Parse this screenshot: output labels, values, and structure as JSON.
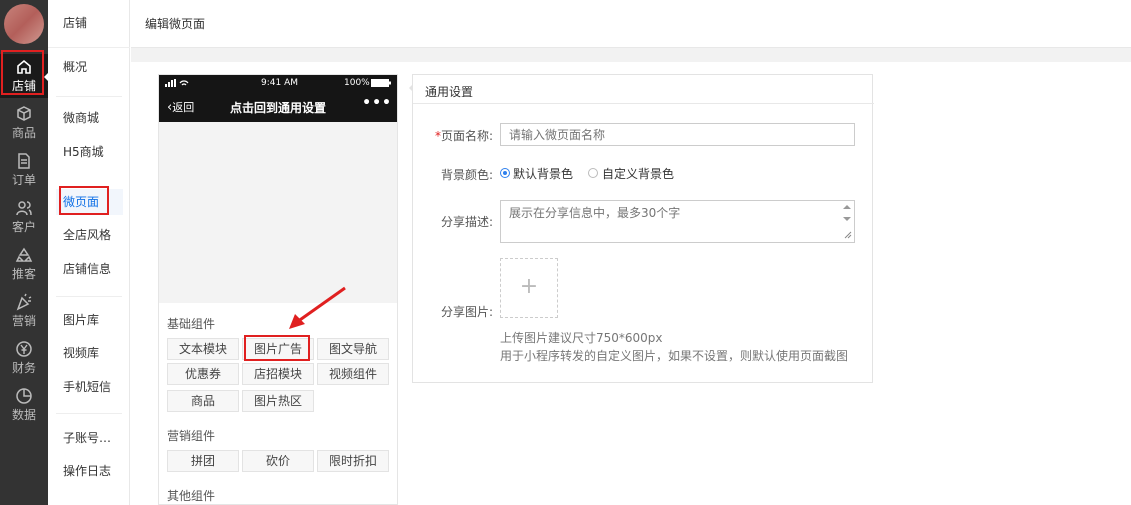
{
  "rail": {
    "items": [
      {
        "label": "店铺",
        "icon": "home-icon"
      },
      {
        "label": "商品",
        "icon": "cube-icon"
      },
      {
        "label": "订单",
        "icon": "document-icon"
      },
      {
        "label": "客户",
        "icon": "users-icon"
      },
      {
        "label": "推客",
        "icon": "recycle-icon"
      },
      {
        "label": "营销",
        "icon": "party-icon"
      },
      {
        "label": "财务",
        "icon": "yen-icon"
      },
      {
        "label": "数据",
        "icon": "pie-chart-icon"
      }
    ]
  },
  "subnav": {
    "title": "店铺",
    "items": [
      "概况",
      "微商城",
      "H5商城",
      "微页面",
      "全店风格",
      "店铺信息",
      "图片库",
      "视频库",
      "手机短信",
      "子账号…",
      "操作日志"
    ]
  },
  "header": {
    "breadcrumb": "编辑微页面"
  },
  "phone": {
    "time": "9:41 AM",
    "battery": "100%",
    "back": "返回",
    "title": "点击回到通用设置",
    "more": "•••",
    "groups": [
      {
        "label": "基础组件",
        "items": [
          "文本模块",
          "图片广告",
          "图文导航",
          "优惠券",
          "店招模块",
          "视频组件",
          "商品",
          "图片热区"
        ]
      },
      {
        "label": "营销组件",
        "items": [
          "拼团",
          "砍价",
          "限时折扣"
        ]
      },
      {
        "label": "其他组件",
        "items": []
      }
    ]
  },
  "form": {
    "tab": "通用设置",
    "name_label": "页面名称:",
    "name_required": "*",
    "name_placeholder": "请输入微页面名称",
    "bg_label": "背景颜色:",
    "bg_options": [
      "默认背景色",
      "自定义背景色"
    ],
    "bg_selected": "默认背景色",
    "share_desc_label": "分享描述:",
    "share_desc_placeholder": "展示在分享信息中，最多30个字",
    "share_img_label": "分享图片:",
    "upload_plus": "+",
    "hint1": "上传图片建议尺寸750*600px",
    "hint2": "用于小程序转发的自定义图片，如果不设置，则默认使用页面截图"
  },
  "colors": {
    "accent": "#1171e6",
    "highlight": "#e02020",
    "rail": "#333333"
  }
}
